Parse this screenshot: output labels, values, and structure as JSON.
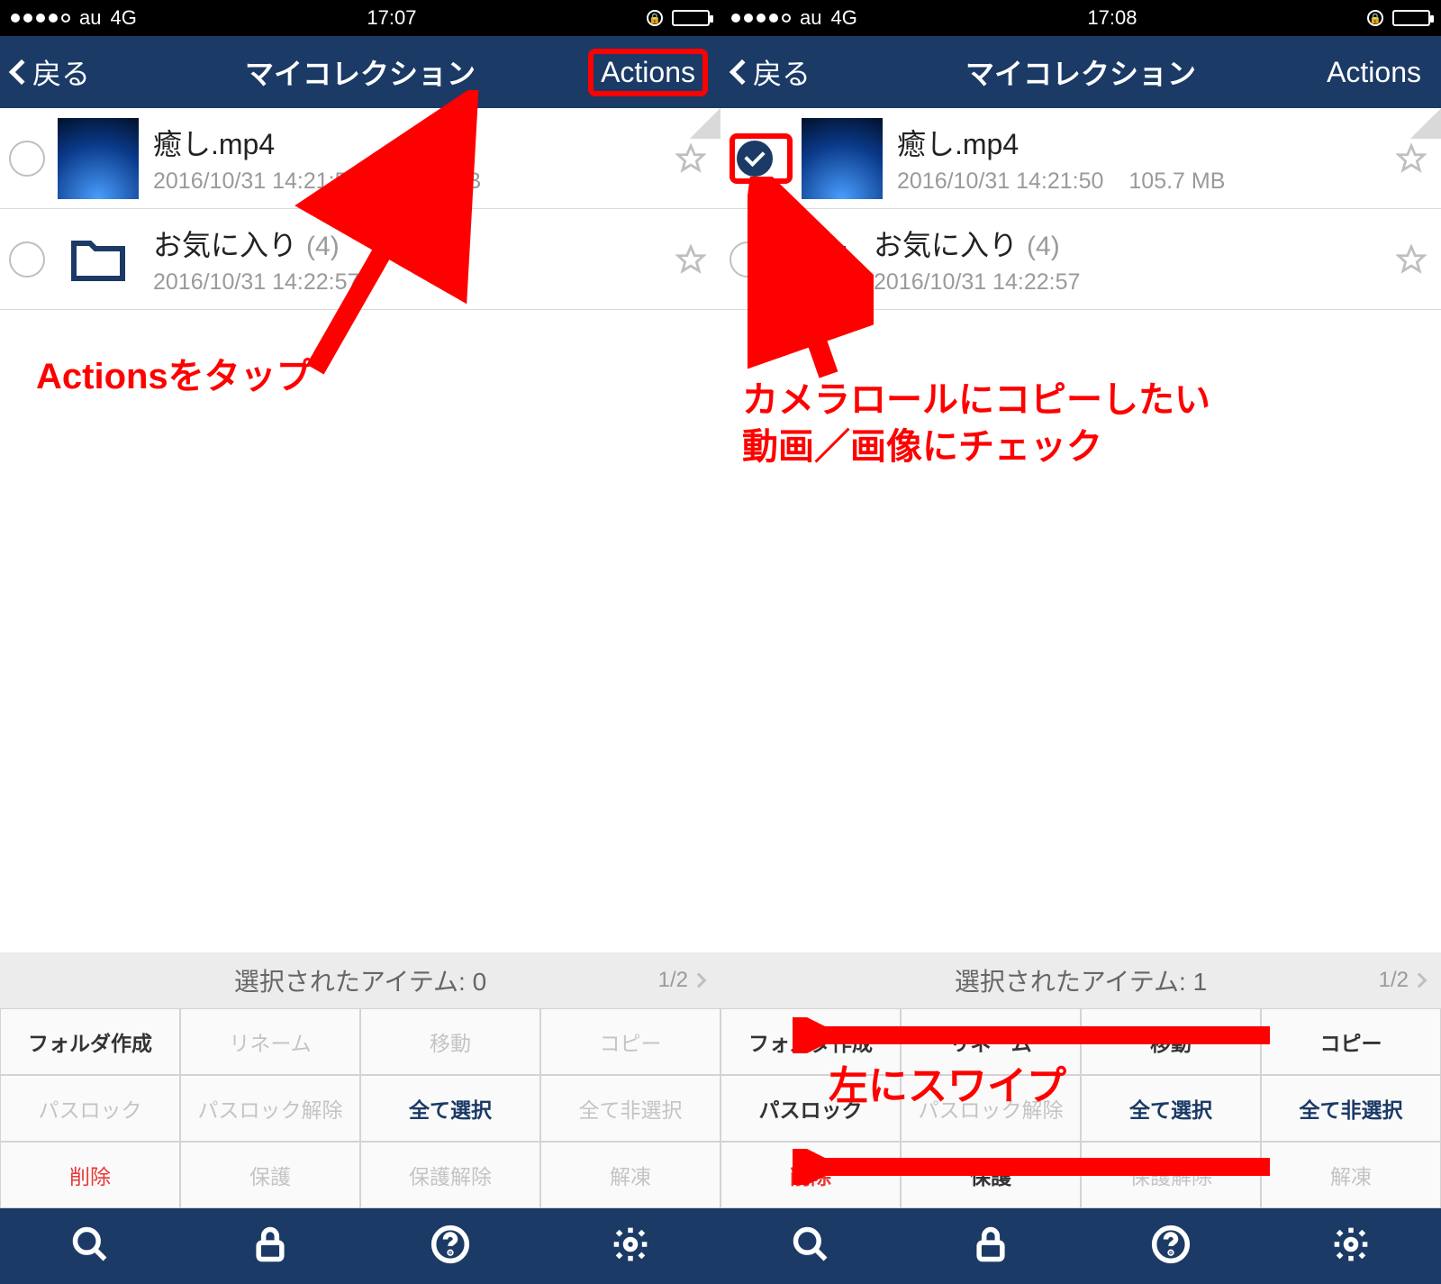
{
  "left": {
    "status": {
      "carrier": "au",
      "network": "4G",
      "time": "17:07"
    },
    "nav": {
      "back": "戻る",
      "title": "マイコレクション",
      "actions": "Actions"
    },
    "items": [
      {
        "name": "癒し.mp4",
        "date": "2016/10/31 14:21:50",
        "size": "105.7 MB",
        "checked": false,
        "kind": "video",
        "dogear": true
      },
      {
        "name": "お気に入り",
        "count": "(4)",
        "date": "2016/10/31 14:22:57",
        "size": "",
        "checked": false,
        "kind": "folder",
        "dogear": false
      }
    ],
    "annotation": "Actionsをタップ",
    "grid_header": "選択されたアイテム: 0",
    "grid_page": "1/2",
    "grid": [
      {
        "t": "フォルダ作成",
        "c": ""
      },
      {
        "t": "リネーム",
        "c": "disabled"
      },
      {
        "t": "移動",
        "c": "disabled"
      },
      {
        "t": "コピー",
        "c": "disabled"
      },
      {
        "t": "パスロック",
        "c": "disabled"
      },
      {
        "t": "パスロック解除",
        "c": "disabled"
      },
      {
        "t": "全て選択",
        "c": "navy"
      },
      {
        "t": "全て非選択",
        "c": "disabled"
      },
      {
        "t": "削除",
        "c": "red"
      },
      {
        "t": "保護",
        "c": "disabled"
      },
      {
        "t": "保護解除",
        "c": "disabled"
      },
      {
        "t": "解凍",
        "c": "disabled"
      }
    ]
  },
  "right": {
    "status": {
      "carrier": "au",
      "network": "4G",
      "time": "17:08"
    },
    "nav": {
      "back": "戻る",
      "title": "マイコレクション",
      "actions": "Actions"
    },
    "items": [
      {
        "name": "癒し.mp4",
        "date": "2016/10/31 14:21:50",
        "size": "105.7 MB",
        "checked": true,
        "kind": "video",
        "dogear": true
      },
      {
        "name": "お気に入り",
        "count": "(4)",
        "date": "2016/10/31 14:22:57",
        "size": "",
        "checked": false,
        "kind": "folder",
        "dogear": false
      }
    ],
    "annotation": "カメラロールにコピーしたい\n動画／画像にチェック",
    "annotation2": "左にスワイプ",
    "grid_header": "選択されたアイテム: 1",
    "grid_page": "1/2",
    "grid": [
      {
        "t": "フォルダ作成",
        "c": ""
      },
      {
        "t": "リネーム",
        "c": ""
      },
      {
        "t": "移動",
        "c": ""
      },
      {
        "t": "コピー",
        "c": ""
      },
      {
        "t": "パスロック",
        "c": ""
      },
      {
        "t": "パスロック解除",
        "c": "disabled"
      },
      {
        "t": "全て選択",
        "c": "navy"
      },
      {
        "t": "全て非選択",
        "c": "navy"
      },
      {
        "t": "削除",
        "c": "redbold"
      },
      {
        "t": "保護",
        "c": ""
      },
      {
        "t": "保護解除",
        "c": "disabled"
      },
      {
        "t": "解凍",
        "c": "disabled"
      }
    ]
  }
}
